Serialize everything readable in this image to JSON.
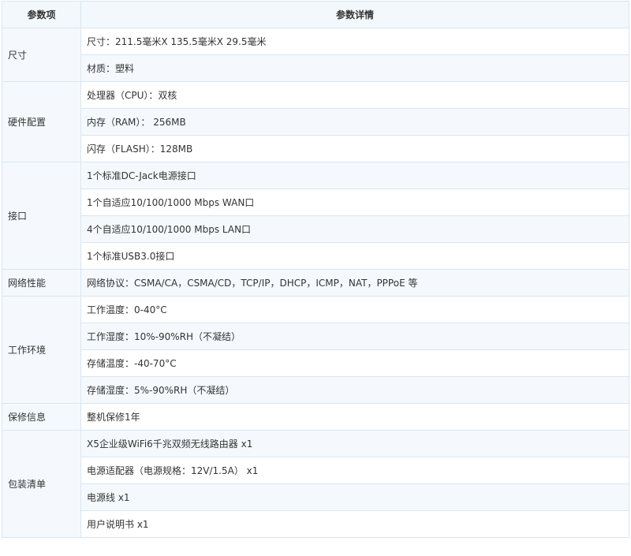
{
  "table": {
    "headers": [
      "参数项",
      "参数详情"
    ],
    "groups": [
      {
        "label": "尺寸",
        "rows": [
          "尺寸：211.5毫米X 135.5毫米X 29.5毫米",
          "材质：塑料"
        ]
      },
      {
        "label": "硬件配置",
        "rows": [
          "处理器（CPU）：双核",
          "内存（RAM）： 256MB",
          "闪存（FLASH）：128MB"
        ]
      },
      {
        "label": "接口",
        "rows": [
          "1个标准DC-Jack电源接口",
          "1个自适应10/100/1000 Mbps WAN口",
          "4个自适应10/100/1000 Mbps LAN口",
          "1个标准USB3.0接口"
        ]
      },
      {
        "label": "网络性能",
        "rows": [
          "网络协议：CSMA/CA，CSMA/CD，TCP/IP，DHCP，ICMP，NAT，PPPoE 等"
        ]
      },
      {
        "label": "工作环境",
        "rows": [
          "工作温度：0-40°C",
          "工作湿度：10%-90%RH（不凝结）",
          "存储温度：-40-70°C",
          "存储湿度：5%-90%RH（不凝结）"
        ]
      },
      {
        "label": "保修信息",
        "rows": [
          "整机保修1年"
        ]
      },
      {
        "label": "包装清单",
        "rows": [
          "X5企业级WiFi6千兆双频无线路由器 x1",
          "电源适配器（电源规格：12V/1.5A） x1",
          "电源线 x1",
          "用户说明书 x1"
        ]
      }
    ]
  }
}
